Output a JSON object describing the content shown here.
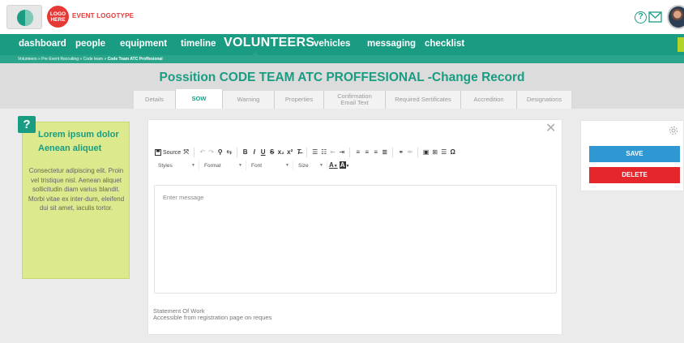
{
  "header": {
    "logo_here": "LOGO HERE",
    "logo_here_line1": "LOGO",
    "logo_here_line2": "HERE",
    "event_logotype": "EVENT LOGOTYPE",
    "icons": [
      "app-logo-icon",
      "help-icon",
      "mail-icon",
      "avatar"
    ]
  },
  "nav": {
    "items": [
      {
        "label": "dashboard"
      },
      {
        "label": "people"
      },
      {
        "label": "equipment"
      },
      {
        "label": "timeline"
      },
      {
        "label": "VOLUNTEERS",
        "active": true
      },
      {
        "label": "vehicles"
      },
      {
        "label": "messaging"
      },
      {
        "label": "checklist"
      }
    ]
  },
  "breadcrumb": {
    "path": "Volunteers » Pre Event Recruiting » Code team » ",
    "current": "Code Team ATC Proffesional"
  },
  "page": {
    "title": "Possition CODE TEAM ATC PROFFESIONAL -Change Record"
  },
  "tabs": [
    {
      "label": "Details"
    },
    {
      "label": "SOW",
      "active": true
    },
    {
      "label": "Warning"
    },
    {
      "label": "Properties"
    },
    {
      "label": "Confirmation Email Text",
      "line1": "Confirmation",
      "line2": "Email Text"
    },
    {
      "label": "Required Sertificates"
    },
    {
      "label": "Accredition"
    },
    {
      "label": "Designations"
    }
  ],
  "note": {
    "badge": "?",
    "title": "Lorem ipsum dolor Aenean aliquet",
    "body": "Consectetur adipiscing elit. Proin vel tristique nisl. Aenean aliquet sollicitudin diam varius blandit. Morbi vitae ex inter-dum, eleifend dui sit amet, iaculis tortor."
  },
  "editor": {
    "toolbar": {
      "source_label": "Source",
      "styles_label": "Styles",
      "format_label": "Format",
      "font_label": "Font",
      "size_label": "Size",
      "font_color_label": "A",
      "bg_color_label": "A"
    },
    "message_placeholder": "Enter message",
    "field_label": "Statement Of Work",
    "field_help": "Accessible from registration page on reques"
  },
  "actions": {
    "save_label": "SAVE",
    "delete_label": "DELETE"
  },
  "colors": {
    "brand": "#1a9c83",
    "nav_bg": "#1a9c83",
    "note_bg": "#dce98c",
    "save": "#2f97d1",
    "delete": "#e5262c",
    "logo_red": "#e53936"
  }
}
